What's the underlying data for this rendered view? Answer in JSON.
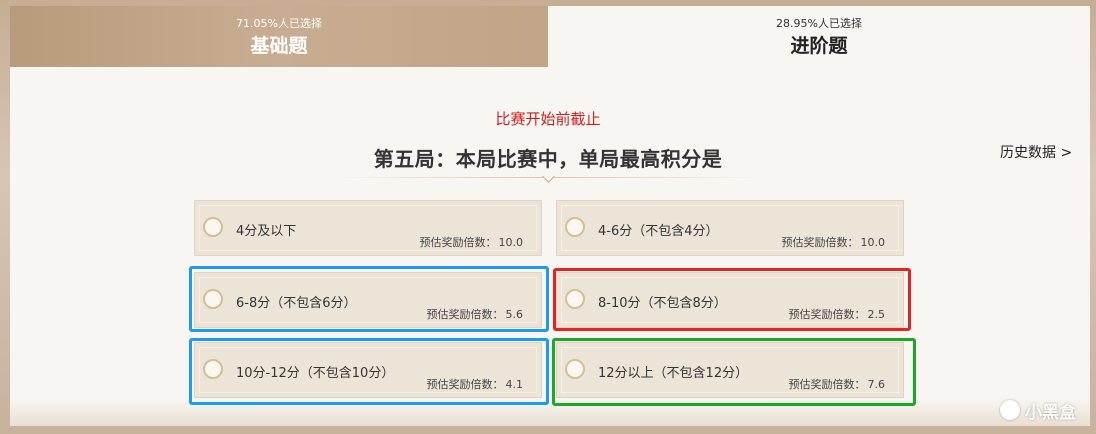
{
  "tabs": [
    {
      "pct": "71.05%人已选择",
      "title": "基础题",
      "active": true
    },
    {
      "pct": "28.95%人已选择",
      "title": "进阶题",
      "active": false
    }
  ],
  "deadline": "比赛开始前截止",
  "question": "第五局：本局比赛中，单局最高积分是",
  "history_link": "历史数据 >",
  "multiplier_label": "预估奖励倍数：",
  "options": [
    {
      "label": "4分及以下",
      "multiplier": "10.0"
    },
    {
      "label": "4-6分（不包含4分）",
      "multiplier": "10.0"
    },
    {
      "label": "6-8分（不包含6分）",
      "multiplier": "5.6"
    },
    {
      "label": "8-10分（不包含8分）",
      "multiplier": "2.5"
    },
    {
      "label": "10分-12分（不包含10分）",
      "multiplier": "4.1"
    },
    {
      "label": "12分以上（不包含12分）",
      "multiplier": "7.6"
    }
  ],
  "highlight_colors": {
    "blue": "#1e9bf0",
    "red": "#e62222",
    "green": "#1ea828"
  },
  "accent_red": "#d21e1e",
  "watermark": "小黑盒"
}
